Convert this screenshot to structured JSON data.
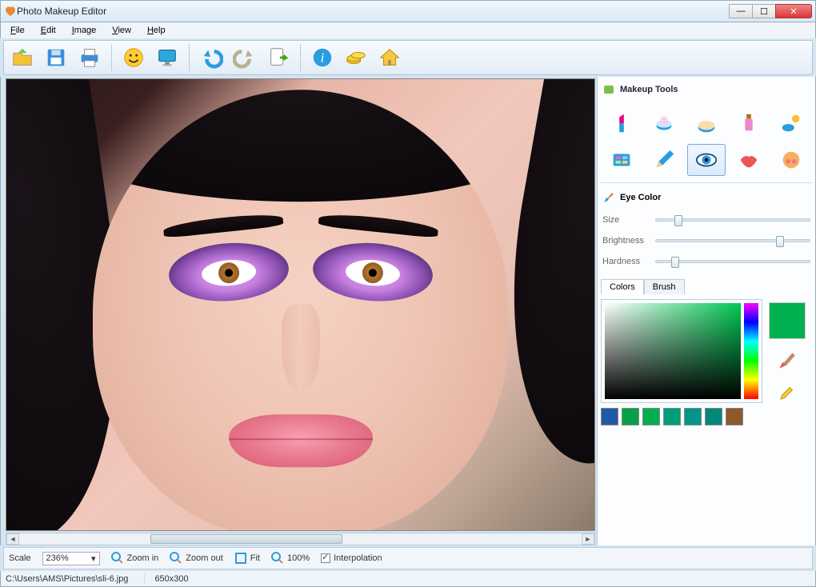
{
  "window": {
    "title": "Photo Makeup Editor"
  },
  "menu": {
    "items": [
      "File",
      "Edit",
      "Image",
      "View",
      "Help"
    ]
  },
  "toolbar": {
    "buttons": [
      "open-icon",
      "save-icon",
      "print-icon",
      "smiley-icon",
      "monitor-icon",
      "undo-icon",
      "redo-icon",
      "export-icon",
      "info-icon",
      "coins-icon",
      "home-icon"
    ]
  },
  "side": {
    "makeup_title": "Makeup Tools",
    "tools": [
      "lipstick",
      "powder",
      "foundation",
      "bottle",
      "suntan",
      "eyeshadow",
      "pencil",
      "eye-color",
      "lips",
      "rouge"
    ],
    "selected_tool": "eye-color",
    "subsection_title": "Eye Color",
    "sliders": {
      "size": {
        "label": "Size",
        "pos": 12
      },
      "brightness": {
        "label": "Brightness",
        "pos": 78
      },
      "hardness": {
        "label": "Hardness",
        "pos": 10
      }
    },
    "tabs": {
      "colors": "Colors",
      "brush": "Brush",
      "active": "colors"
    },
    "selected_color": "#00b050",
    "swatches": [
      "#1e5aa8",
      "#0aa04a",
      "#00b050",
      "#009e7a",
      "#009688",
      "#00897b",
      "#8d5a2b"
    ]
  },
  "zoombar": {
    "scale_label": "Scale",
    "scale_value": "236%",
    "zoom_in": "Zoom in",
    "zoom_out": "Zoom out",
    "fit": "Fit",
    "hundred": "100%",
    "interpolation": "Interpolation"
  },
  "status": {
    "path": "C:\\Users\\AMS\\Pictures\\sli-6.jpg",
    "dims": "650x300"
  }
}
